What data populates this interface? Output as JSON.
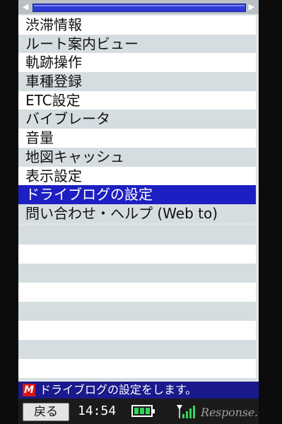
{
  "scrollbar": {
    "left_arrow": "◀",
    "right_arrow": "▶"
  },
  "menu": {
    "items": [
      {
        "label": "渋滞情報"
      },
      {
        "label": "ルート案内ビュー"
      },
      {
        "label": "軌跡操作"
      },
      {
        "label": "車種登録"
      },
      {
        "label": "ETC設定"
      },
      {
        "label": "バイブレータ"
      },
      {
        "label": "音量"
      },
      {
        "label": "地図キャッシュ"
      },
      {
        "label": "表示設定"
      },
      {
        "label": "ドライブログの設定",
        "selected": true
      },
      {
        "label": "問い合わせ・ヘルプ (Web to)"
      }
    ]
  },
  "status": {
    "icon_letter": "M",
    "message": "ドライブログの設定をします。"
  },
  "bottom_bar": {
    "back_label": "戻る",
    "time": "14:54",
    "battery_level": 1.0,
    "watermark": "Response."
  },
  "colors": {
    "selection": "#1d1fc2",
    "status_bar": "#1a1a8c",
    "scroll_track": "#2d3bd6",
    "battery": "#35d35a",
    "brand_icon": "#d81515"
  }
}
